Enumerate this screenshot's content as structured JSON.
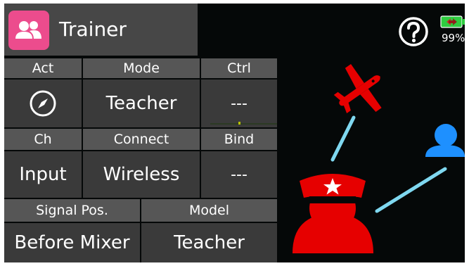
{
  "title": "Trainer",
  "status": {
    "battery_percent": "99%",
    "battery_level": 0.99,
    "battery_color": "#2ecc40"
  },
  "grid": {
    "row1_headers": [
      "Act",
      "Mode",
      "Ctrl"
    ],
    "row1_values": {
      "mode": "Teacher",
      "ctrl": "---"
    },
    "row2_headers": [
      "Ch",
      "Connect",
      "Bind"
    ],
    "row2_values": {
      "ch": "Input",
      "connect": "Wireless",
      "bind": "---"
    },
    "row3_headers": [
      "Signal Pos.",
      "Model"
    ],
    "row3_values": {
      "signal_pos": "Before Mixer",
      "model": "Teacher"
    }
  },
  "icons": {
    "app": "trainer-users-icon",
    "act": "compass-icon",
    "help": "help-icon",
    "battery": "battery-icon",
    "airplane": "airplane-icon",
    "teacher": "teacher-avatar-icon",
    "student": "student-avatar-icon"
  },
  "colors": {
    "app_icon": "#ec4c8d",
    "airplane": "#e60000",
    "teacher": "#e60000",
    "student": "#1e90ff",
    "link_line": "#7fd8f0"
  }
}
